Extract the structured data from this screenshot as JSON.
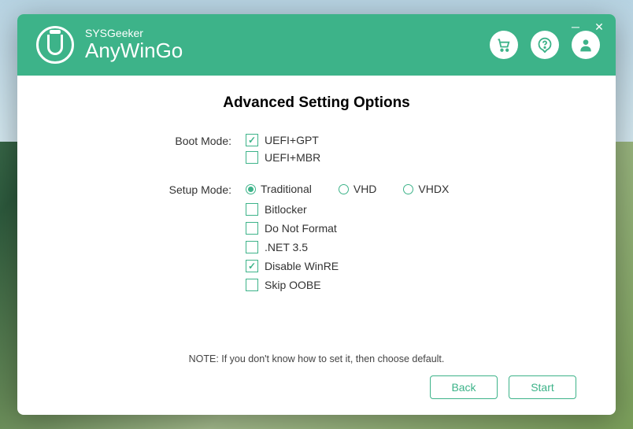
{
  "brand": {
    "small": "SYSGeeker",
    "big": "AnyWinGo"
  },
  "heading": "Advanced Setting Options",
  "labels": {
    "boot_mode": "Boot Mode:",
    "setup_mode": "Setup Mode:"
  },
  "boot_mode": {
    "options": [
      {
        "label": "UEFI+GPT",
        "checked": true
      },
      {
        "label": "UEFI+MBR",
        "checked": false
      }
    ]
  },
  "setup_mode": {
    "options": [
      {
        "label": "Traditional",
        "selected": true
      },
      {
        "label": "VHD",
        "selected": false
      },
      {
        "label": "VHDX",
        "selected": false
      }
    ]
  },
  "extras": [
    {
      "label": "Bitlocker",
      "checked": false
    },
    {
      "label": "Do Not Format",
      "checked": false
    },
    {
      "label": ".NET 3.5",
      "checked": false
    },
    {
      "label": "Disable WinRE",
      "checked": true
    },
    {
      "label": "Skip OOBE",
      "checked": false
    }
  ],
  "note": "NOTE: If you don't know how to set it, then choose default.",
  "buttons": {
    "back": "Back",
    "start": "Start"
  },
  "colors": {
    "accent": "#3db389"
  }
}
